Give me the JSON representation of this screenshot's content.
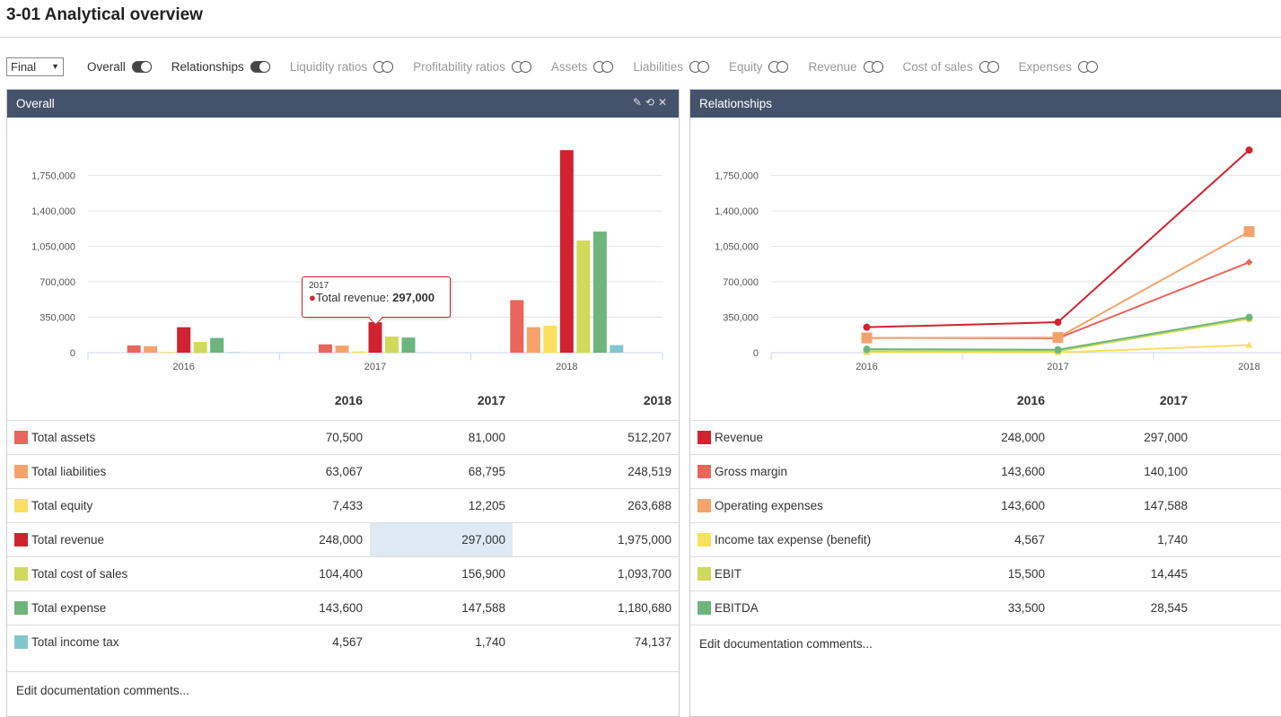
{
  "page": {
    "title": "3-01 Analytical overview"
  },
  "toolbar": {
    "select_value": "Final",
    "toggles": [
      {
        "label": "Overall",
        "on": true
      },
      {
        "label": "Relationships",
        "on": true
      },
      {
        "label": "Liquidity ratios",
        "on": false
      },
      {
        "label": "Profitability ratios",
        "on": false
      },
      {
        "label": "Assets",
        "on": false
      },
      {
        "label": "Liabilities",
        "on": false
      },
      {
        "label": "Equity",
        "on": false
      },
      {
        "label": "Revenue",
        "on": false
      },
      {
        "label": "Cost of sales",
        "on": false
      },
      {
        "label": "Expenses",
        "on": false
      }
    ]
  },
  "left": {
    "title": "Overall",
    "icons": [
      "pencil-icon",
      "history-icon",
      "close-icon"
    ],
    "tooltip": {
      "year": "2017",
      "label": "Total revenue: ",
      "value": "297,000"
    },
    "table": {
      "columns": [
        "2016",
        "2017",
        "2018"
      ],
      "rows": [
        {
          "label": "Total assets",
          "color": "#e8665a",
          "values": [
            "70,500",
            "81,000",
            "512,207"
          ]
        },
        {
          "label": "Total liabilities",
          "color": "#f4a36c",
          "values": [
            "63,067",
            "68,795",
            "248,519"
          ]
        },
        {
          "label": "Total equity",
          "color": "#f9e05e",
          "values": [
            "7,433",
            "12,205",
            "263,688"
          ]
        },
        {
          "label": "Total revenue",
          "color": "#d0232f",
          "values": [
            "248,000",
            "297,000",
            "1,975,000"
          ]
        },
        {
          "label": "Total cost of sales",
          "color": "#cfd95c",
          "values": [
            "104,400",
            "156,900",
            "1,093,700"
          ]
        },
        {
          "label": "Total expense",
          "color": "#6db57b",
          "values": [
            "143,600",
            "147,588",
            "1,180,680"
          ]
        },
        {
          "label": "Total income tax",
          "color": "#82c6cc",
          "values": [
            "4,567",
            "1,740",
            "74,137"
          ]
        }
      ]
    },
    "footer": "Edit documentation comments..."
  },
  "right": {
    "title": "Relationships",
    "table": {
      "columns": [
        "2016",
        "2017"
      ],
      "rows": [
        {
          "label": "Revenue",
          "color": "#d0232f",
          "values": [
            "248,000",
            "297,000"
          ]
        },
        {
          "label": "Gross margin",
          "color": "#e8665a",
          "values": [
            "143,600",
            "140,100"
          ]
        },
        {
          "label": "Operating expenses",
          "color": "#f4a36c",
          "values": [
            "143,600",
            "147,588"
          ]
        },
        {
          "label": "Income tax expense (benefit)",
          "color": "#f9e05e",
          "values": [
            "4,567",
            "1,740"
          ]
        },
        {
          "label": "EBIT",
          "color": "#cfd95c",
          "values": [
            "15,500",
            "14,445"
          ]
        },
        {
          "label": "EBITDA",
          "color": "#6db57b",
          "values": [
            "33,500",
            "28,545"
          ]
        }
      ]
    },
    "footer": "Edit documentation comments..."
  },
  "chart_data": [
    {
      "type": "bar",
      "categories": [
        "2016",
        "2017",
        "2018"
      ],
      "yticks": [
        "0",
        "350,000",
        "700,000",
        "1,050,000",
        "1,400,000",
        "1,750,000"
      ],
      "ylim": [
        0,
        2100000
      ],
      "grid": true,
      "series": [
        {
          "name": "Total assets",
          "color": "#e8665a",
          "values": [
            70500,
            81000,
            512207
          ]
        },
        {
          "name": "Total liabilities",
          "color": "#f4a36c",
          "values": [
            63067,
            68795,
            248519
          ]
        },
        {
          "name": "Total equity",
          "color": "#f9e05e",
          "values": [
            7433,
            12205,
            263688
          ]
        },
        {
          "name": "Total revenue",
          "color": "#d0232f",
          "values": [
            248000,
            297000,
            1975000
          ]
        },
        {
          "name": "Total cost of sales",
          "color": "#cfd95c",
          "values": [
            104400,
            156900,
            1093700
          ]
        },
        {
          "name": "Total expense",
          "color": "#6db57b",
          "values": [
            143600,
            147588,
            1180680
          ]
        },
        {
          "name": "Total income tax",
          "color": "#82c6cc",
          "values": [
            4567,
            1740,
            74137
          ]
        }
      ]
    },
    {
      "type": "line",
      "categories": [
        "2016",
        "2017",
        "2018"
      ],
      "yticks": [
        "0",
        "350,000",
        "700,000",
        "1,050,000",
        "1,400,000",
        "1,750,000"
      ],
      "ylim": [
        0,
        2100000
      ],
      "grid": true,
      "series": [
        {
          "name": "Revenue",
          "color": "#d0232f",
          "marker": "circle",
          "values": [
            248000,
            297000,
            1975000
          ]
        },
        {
          "name": "Gross margin",
          "color": "#e8665a",
          "marker": "diamond",
          "values": [
            143600,
            140100,
            881300
          ]
        },
        {
          "name": "Operating expenses",
          "color": "#f4a36c",
          "marker": "square",
          "values": [
            143600,
            147588,
            1180680
          ]
        },
        {
          "name": "Income tax expense (benefit)",
          "color": "#f9e05e",
          "marker": "triangle",
          "values": [
            4567,
            1740,
            74137
          ]
        },
        {
          "name": "EBIT",
          "color": "#cfd95c",
          "marker": "circle",
          "values": [
            15500,
            14445,
            330000
          ]
        },
        {
          "name": "EBITDA",
          "color": "#6db57b",
          "marker": "circle",
          "values": [
            33500,
            28545,
            345000
          ]
        }
      ]
    }
  ]
}
